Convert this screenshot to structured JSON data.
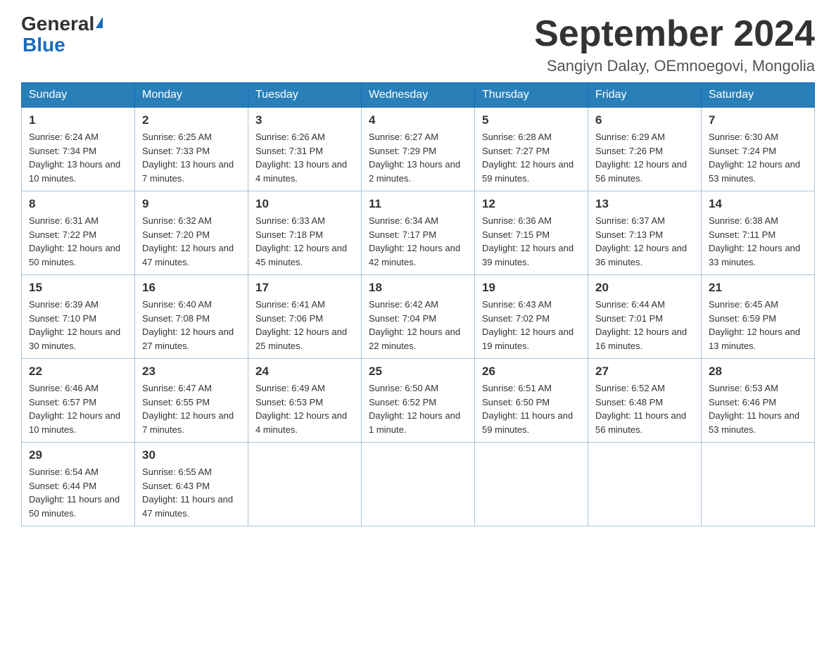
{
  "header": {
    "logo_general": "General",
    "logo_blue": "Blue",
    "month_title": "September 2024",
    "location": "Sangiyn Dalay, OEmnoegovi, Mongolia"
  },
  "weekdays": [
    "Sunday",
    "Monday",
    "Tuesday",
    "Wednesday",
    "Thursday",
    "Friday",
    "Saturday"
  ],
  "weeks": [
    [
      {
        "day": "1",
        "sunrise": "6:24 AM",
        "sunset": "7:34 PM",
        "daylight": "13 hours and 10 minutes."
      },
      {
        "day": "2",
        "sunrise": "6:25 AM",
        "sunset": "7:33 PM",
        "daylight": "13 hours and 7 minutes."
      },
      {
        "day": "3",
        "sunrise": "6:26 AM",
        "sunset": "7:31 PM",
        "daylight": "13 hours and 4 minutes."
      },
      {
        "day": "4",
        "sunrise": "6:27 AM",
        "sunset": "7:29 PM",
        "daylight": "13 hours and 2 minutes."
      },
      {
        "day": "5",
        "sunrise": "6:28 AM",
        "sunset": "7:27 PM",
        "daylight": "12 hours and 59 minutes."
      },
      {
        "day": "6",
        "sunrise": "6:29 AM",
        "sunset": "7:26 PM",
        "daylight": "12 hours and 56 minutes."
      },
      {
        "day": "7",
        "sunrise": "6:30 AM",
        "sunset": "7:24 PM",
        "daylight": "12 hours and 53 minutes."
      }
    ],
    [
      {
        "day": "8",
        "sunrise": "6:31 AM",
        "sunset": "7:22 PM",
        "daylight": "12 hours and 50 minutes."
      },
      {
        "day": "9",
        "sunrise": "6:32 AM",
        "sunset": "7:20 PM",
        "daylight": "12 hours and 47 minutes."
      },
      {
        "day": "10",
        "sunrise": "6:33 AM",
        "sunset": "7:18 PM",
        "daylight": "12 hours and 45 minutes."
      },
      {
        "day": "11",
        "sunrise": "6:34 AM",
        "sunset": "7:17 PM",
        "daylight": "12 hours and 42 minutes."
      },
      {
        "day": "12",
        "sunrise": "6:36 AM",
        "sunset": "7:15 PM",
        "daylight": "12 hours and 39 minutes."
      },
      {
        "day": "13",
        "sunrise": "6:37 AM",
        "sunset": "7:13 PM",
        "daylight": "12 hours and 36 minutes."
      },
      {
        "day": "14",
        "sunrise": "6:38 AM",
        "sunset": "7:11 PM",
        "daylight": "12 hours and 33 minutes."
      }
    ],
    [
      {
        "day": "15",
        "sunrise": "6:39 AM",
        "sunset": "7:10 PM",
        "daylight": "12 hours and 30 minutes."
      },
      {
        "day": "16",
        "sunrise": "6:40 AM",
        "sunset": "7:08 PM",
        "daylight": "12 hours and 27 minutes."
      },
      {
        "day": "17",
        "sunrise": "6:41 AM",
        "sunset": "7:06 PM",
        "daylight": "12 hours and 25 minutes."
      },
      {
        "day": "18",
        "sunrise": "6:42 AM",
        "sunset": "7:04 PM",
        "daylight": "12 hours and 22 minutes."
      },
      {
        "day": "19",
        "sunrise": "6:43 AM",
        "sunset": "7:02 PM",
        "daylight": "12 hours and 19 minutes."
      },
      {
        "day": "20",
        "sunrise": "6:44 AM",
        "sunset": "7:01 PM",
        "daylight": "12 hours and 16 minutes."
      },
      {
        "day": "21",
        "sunrise": "6:45 AM",
        "sunset": "6:59 PM",
        "daylight": "12 hours and 13 minutes."
      }
    ],
    [
      {
        "day": "22",
        "sunrise": "6:46 AM",
        "sunset": "6:57 PM",
        "daylight": "12 hours and 10 minutes."
      },
      {
        "day": "23",
        "sunrise": "6:47 AM",
        "sunset": "6:55 PM",
        "daylight": "12 hours and 7 minutes."
      },
      {
        "day": "24",
        "sunrise": "6:49 AM",
        "sunset": "6:53 PM",
        "daylight": "12 hours and 4 minutes."
      },
      {
        "day": "25",
        "sunrise": "6:50 AM",
        "sunset": "6:52 PM",
        "daylight": "12 hours and 1 minute."
      },
      {
        "day": "26",
        "sunrise": "6:51 AM",
        "sunset": "6:50 PM",
        "daylight": "11 hours and 59 minutes."
      },
      {
        "day": "27",
        "sunrise": "6:52 AM",
        "sunset": "6:48 PM",
        "daylight": "11 hours and 56 minutes."
      },
      {
        "day": "28",
        "sunrise": "6:53 AM",
        "sunset": "6:46 PM",
        "daylight": "11 hours and 53 minutes."
      }
    ],
    [
      {
        "day": "29",
        "sunrise": "6:54 AM",
        "sunset": "6:44 PM",
        "daylight": "11 hours and 50 minutes."
      },
      {
        "day": "30",
        "sunrise": "6:55 AM",
        "sunset": "6:43 PM",
        "daylight": "11 hours and 47 minutes."
      },
      null,
      null,
      null,
      null,
      null
    ]
  ]
}
